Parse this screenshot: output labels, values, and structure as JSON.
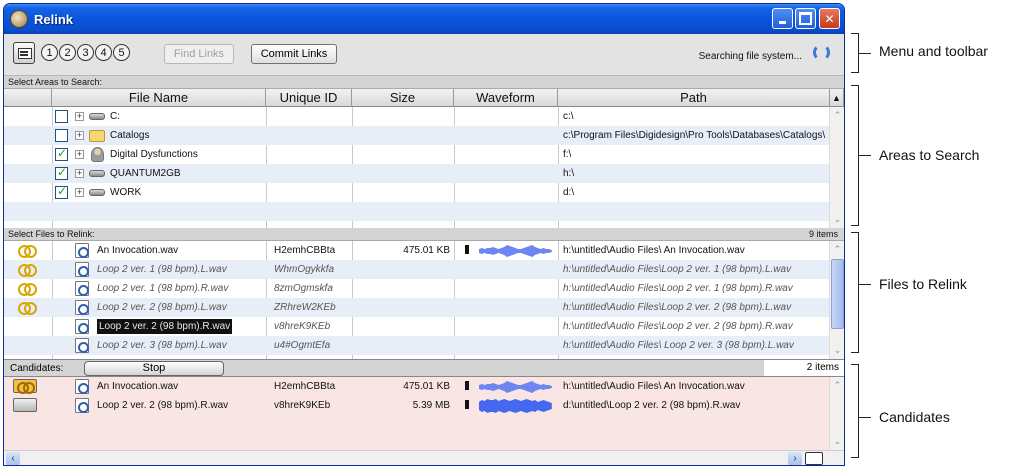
{
  "window": {
    "title": "Relink"
  },
  "toolbar": {
    "steps": [
      "1",
      "2",
      "3",
      "4",
      "5"
    ],
    "find_links": "Find Links",
    "commit_links": "Commit Links",
    "status": "Searching file system..."
  },
  "areas": {
    "section_label": "Select Areas to Search:",
    "columns": [
      "File Name",
      "Unique ID",
      "Size",
      "Waveform",
      "Path"
    ],
    "rows": [
      {
        "name": "C:",
        "path": "c:\\",
        "checked": false,
        "icon": "disk-icon"
      },
      {
        "name": "Catalogs",
        "path": "c:\\Program Files\\Digidesign\\Pro Tools\\Databases\\Catalogs\\",
        "checked": false,
        "icon": "folder-icon"
      },
      {
        "name": "Digital Dysfunctions",
        "path": "f:\\",
        "checked": true,
        "icon": "user-volume-icon"
      },
      {
        "name": "QUANTUM2GB",
        "path": "h:\\",
        "checked": true,
        "icon": "disk-icon"
      },
      {
        "name": "WORK",
        "path": "d:\\",
        "checked": true,
        "icon": "disk-icon"
      }
    ]
  },
  "files": {
    "section_label": "Select Files to Relink:",
    "count": "9 items",
    "rows": [
      {
        "name": "An Invocation.wav",
        "uid": "H2emhCBBta",
        "size": "475.01 KB",
        "path": "h:\\untitled\\Audio Files\\ An Invocation.wav",
        "italic": false,
        "link": true,
        "waveform": true
      },
      {
        "name": "Loop 2  ver. 1 (98 bpm).L.wav",
        "uid": "WhmOgykkfa",
        "size": "",
        "path": "h:\\untitled\\Audio Files\\Loop 2  ver. 1 (98 bpm).L.wav",
        "italic": true,
        "link": true,
        "waveform": false
      },
      {
        "name": "Loop 2  ver. 1 (98 bpm).R.wav",
        "uid": "8zmOgmskfa",
        "size": "",
        "path": "h:\\untitled\\Audio Files\\Loop 2  ver. 1 (98 bpm).R.wav",
        "italic": true,
        "link": true,
        "waveform": false
      },
      {
        "name": "Loop 2  ver. 2 (98 bpm).L.wav",
        "uid": "ZRhreW2KEb",
        "size": "",
        "path": "h:\\untitled\\Audio Files\\Loop 2  ver. 2 (98 bpm).L.wav",
        "italic": true,
        "link": true,
        "waveform": false
      },
      {
        "name": "Loop 2  ver. 2 (98 bpm).R.wav",
        "uid": "v8hreK9KEb",
        "size": "",
        "path": "h:\\untitled\\Audio Files\\Loop 2  ver. 2 (98 bpm).R.wav",
        "italic": true,
        "link": false,
        "waveform": false,
        "selected": true
      },
      {
        "name": "Loop 2  ver. 3 (98 bpm).L.wav",
        "uid": "u4#OgmtEfa",
        "size": "",
        "path": "h:\\untitled\\Audio Files\\ Loop 2  ver. 3 (98 bpm).L.wav",
        "italic": true,
        "link": false,
        "waveform": false
      }
    ]
  },
  "candidates": {
    "label": "Candidates:",
    "stop": "Stop",
    "count": "2 items",
    "rows": [
      {
        "name": "An Invocation.wav",
        "uid": "H2emhCBBta",
        "size": "475.01 KB",
        "path": "h:\\untitled\\Audio Files\\ An Invocation.wav",
        "linked": true
      },
      {
        "name": "Loop 2  ver. 2 (98 bpm).R.wav",
        "uid": "v8hreK9KEb",
        "size": "5.39 MB",
        "path": "d:\\untitled\\Loop 2  ver. 2 (98 bpm).R.wav",
        "linked": false
      }
    ]
  },
  "callouts": {
    "menu": "Menu and toolbar",
    "areas": "Areas to Search",
    "files": "Files to Relink",
    "candidates": "Candidates"
  }
}
